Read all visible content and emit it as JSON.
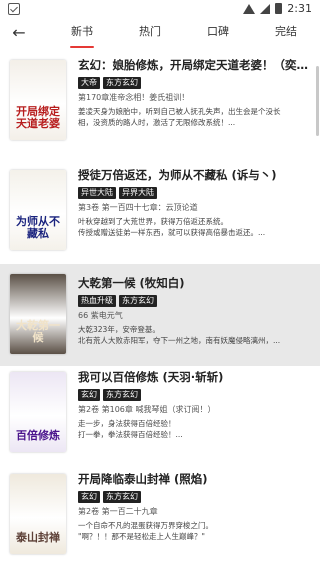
{
  "status_bar": {
    "time": "2:31"
  },
  "nav": {
    "tabs": [
      {
        "label": "新书",
        "active": true
      },
      {
        "label": "热门",
        "active": false
      },
      {
        "label": "口碑",
        "active": false
      },
      {
        "label": "完结",
        "active": false
      }
    ]
  },
  "books": [
    {
      "title": "玄幻：娘胎修炼，开局绑定天道老婆！（奕辣条...",
      "tags": [
        "大帝",
        "东方玄幻"
      ],
      "chapter": "第170章准帝念相！姜氏祖训！",
      "desc": [
        "姜凌天身为娘胎中，听到自己被人抚孔失声，出生会是个没长",
        "相，没资质的路人时，激活了无限修改系统！..."
      ],
      "cover_text": "开局绑定天道老婆",
      "cover_bg": "#f3efe8",
      "cover_color": "#b71c1c",
      "selected": false
    },
    {
      "title": "授徒万倍返还，为师从不藏私 (诉与丶)",
      "tags": [
        "异世大陆",
        "异界大陆"
      ],
      "chapter": "第3卷 第一百四十七章：云顶论道",
      "desc": [
        "叶秋穿越到了大荒世界，获得万倍返还系统。",
        "传授或赠送徒弟一样东西，就可以获得高倍暴击返还。..."
      ],
      "cover_text": "为师从不藏私",
      "cover_bg": "#f4f1ea",
      "cover_color": "#1a237e",
      "selected": false
    },
    {
      "title": "大乾第一候 (牧知白)",
      "tags": [
        "热血升级",
        "东方玄幻"
      ],
      "chapter": "66 紫电元气",
      "desc": [
        "大乾323年，安帝登基。",
        "北有荒人大败赤阳军，夺下一州之地，南有妖魔侵略漓州，..."
      ],
      "cover_text": "大乾第一候",
      "cover_bg": "#5b5046",
      "cover_color": "#f1e3c8",
      "selected": true
    },
    {
      "title": "我可以百倍修炼 (天羽·斩斩)",
      "tags": [
        "玄幻",
        "东方玄幻"
      ],
      "chapter": "第2卷 第106章 喊我琴姐（求订阅！）",
      "desc": [
        "走一步，身法获得百倍经验！",
        "打一拳，拳法获得百倍经验！..."
      ],
      "cover_text": "百倍修炼",
      "cover_bg": "#ece6f4",
      "cover_color": "#4a148c",
      "selected": false
    },
    {
      "title": "开局降临泰山封禅 (照焰)",
      "tags": [
        "玄幻",
        "东方玄幻"
      ],
      "chapter": "第2卷 第一百二十九章",
      "desc": [
        "一个自命不凡的混蛋获得万界穿梭之门。",
        "\"啊？！！那不是轻松走上人生巅峰？\""
      ],
      "cover_text": "泰山封禅",
      "cover_bg": "#efe9dd",
      "cover_color": "#5d4037",
      "selected": false
    }
  ]
}
